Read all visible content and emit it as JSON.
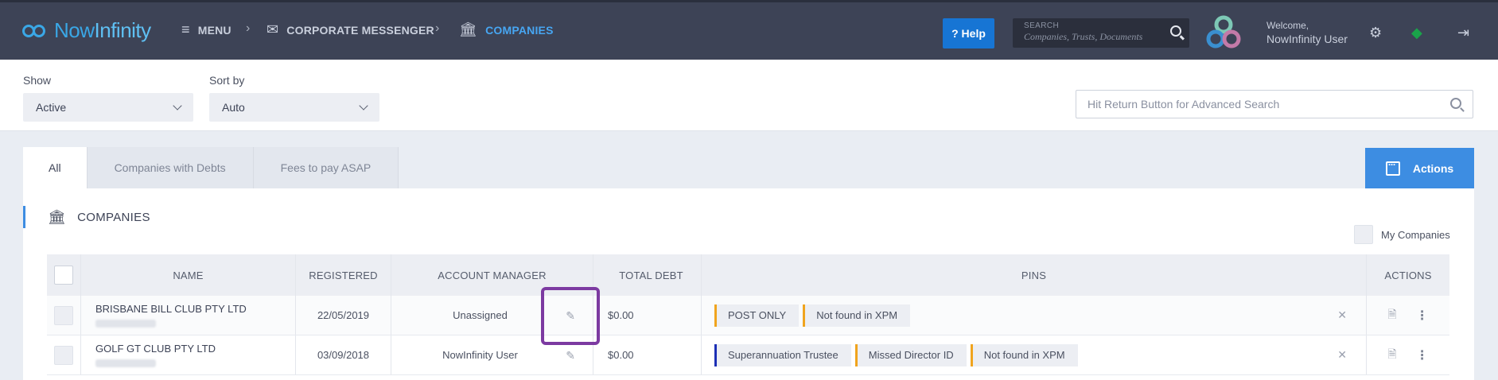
{
  "header": {
    "logo_now": "Now",
    "logo_infinity": "Infinity",
    "menu_label": "MENU",
    "breadcrumb_1": "CORPORATE MESSENGER",
    "breadcrumb_2": "COMPANIES",
    "help_label": "? Help",
    "search_label": "SEARCH",
    "search_placeholder": "Companies, Trusts, Documents",
    "welcome": "Welcome,",
    "user_name": "NowInfinity User",
    "accent_color": "#47a6f2"
  },
  "filters": {
    "show_label": "Show",
    "show_value": "Active",
    "sort_label": "Sort by",
    "sort_value": "Auto",
    "advanced_search_placeholder": "Hit Return Button for Advanced Search"
  },
  "tabs": [
    {
      "label": "All",
      "active": true
    },
    {
      "label": "Companies with Debts",
      "active": false
    },
    {
      "label": "Fees to pay ASAP",
      "active": false
    }
  ],
  "actions_label": "Actions",
  "panel": {
    "title": "COMPANIES",
    "my_companies_label": "My Companies"
  },
  "table": {
    "columns": [
      "NAME",
      "REGISTERED",
      "ACCOUNT MANAGER",
      "TOTAL DEBT",
      "PINS",
      "ACTIONS"
    ],
    "rows": [
      {
        "name": "BRISBANE BILL CLUB PTY LTD",
        "registered": "22/05/2019",
        "manager": "Unassigned",
        "debt": "$0.00",
        "pins": [
          {
            "label": "POST ONLY",
            "color": "#f0a41e"
          },
          {
            "label": "Not found in XPM",
            "color": "#f0a41e"
          }
        ]
      },
      {
        "name": "GOLF GT CLUB PTY LTD",
        "registered": "03/09/2018",
        "manager": "NowInfinity User",
        "debt": "$0.00",
        "pins": [
          {
            "label": "Superannuation Trustee",
            "color": "#1c2fb5"
          },
          {
            "label": "Missed Director ID",
            "color": "#f0a41e"
          },
          {
            "label": "Not found in XPM",
            "color": "#f0a41e"
          }
        ]
      }
    ]
  },
  "highlight_color": "#7c3aa1"
}
